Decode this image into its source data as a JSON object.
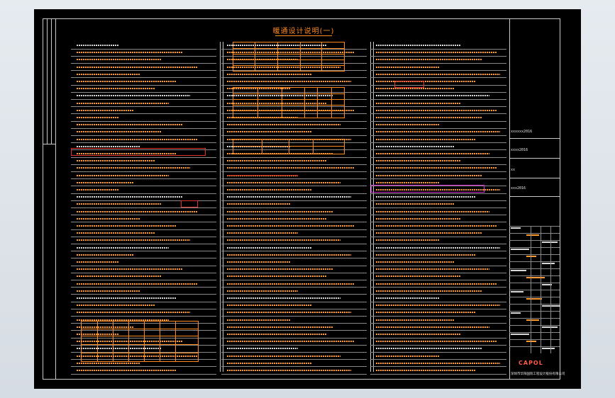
{
  "sheet": {
    "title": "暖通设计说明(一)",
    "logo_text": "CAPOL",
    "company_text": "深圳市华阳国际工程设计股份有限公司"
  },
  "colors": {
    "background": "#000000",
    "text_orange": "#ff9b30",
    "text_white": "#e8e8e8",
    "frame": "#c9c9c9",
    "highlight_red": "#e0302a",
    "highlight_magenta": "#d22ad2"
  },
  "title_block": {
    "labels": [
      "xxxxxx2016",
      "xxxx2016",
      "xx",
      "xxx2016"
    ]
  }
}
